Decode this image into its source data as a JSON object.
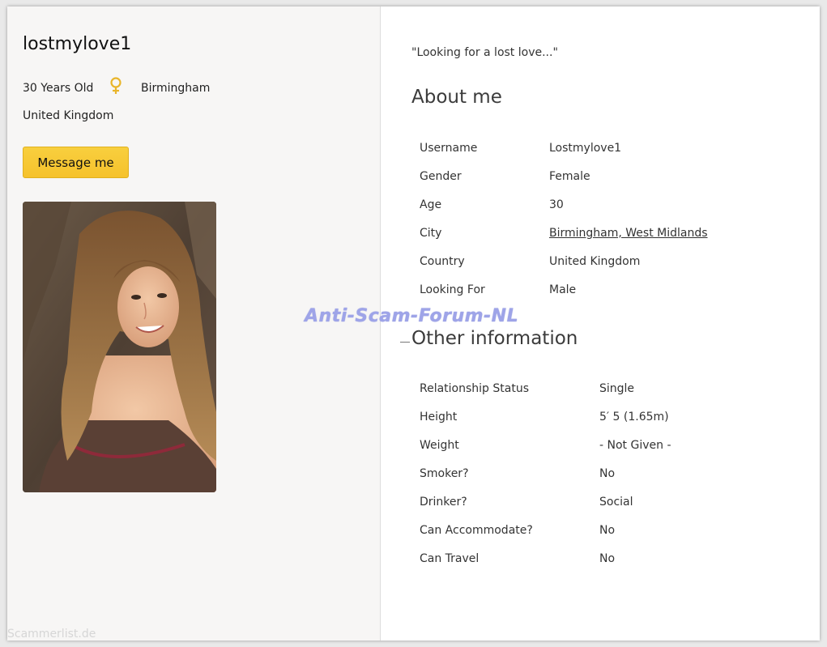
{
  "profile": {
    "username": "lostmylove1",
    "age_text": "30 Years Old",
    "city": "Birmingham",
    "country": "United Kingdom",
    "message_button": "Message me",
    "tagline": "\"Looking for a lost love...\""
  },
  "about": {
    "title": "About me",
    "rows": [
      {
        "key": "Username",
        "value": "Lostmylove1"
      },
      {
        "key": "Gender",
        "value": "Female"
      },
      {
        "key": "Age",
        "value": "30"
      },
      {
        "key": "City",
        "value": "Birmingham, West Midlands"
      },
      {
        "key": "Country",
        "value": "United Kingdom"
      },
      {
        "key": "Looking For",
        "value": "Male"
      }
    ]
  },
  "other": {
    "title": "Other information",
    "rows": [
      {
        "key": "Relationship Status",
        "value": "Single"
      },
      {
        "key": "Height",
        "value": "5′ 5 (1.65m)"
      },
      {
        "key": "Weight",
        "value": "- Not Given -"
      },
      {
        "key": "Smoker?",
        "value": "No"
      },
      {
        "key": "Drinker?",
        "value": "Social"
      },
      {
        "key": "Can Accommodate?",
        "value": "No"
      },
      {
        "key": "Can Travel",
        "value": "No"
      }
    ]
  },
  "watermark": "Anti-Scam-Forum-NL",
  "corner_watermark": "Scammerlist.de",
  "icons": {
    "gender": "female-symbol-icon"
  },
  "colors": {
    "accent": "#f6c22c",
    "gender_icon": "#e9b52a",
    "watermark": "#9ea4e8"
  }
}
